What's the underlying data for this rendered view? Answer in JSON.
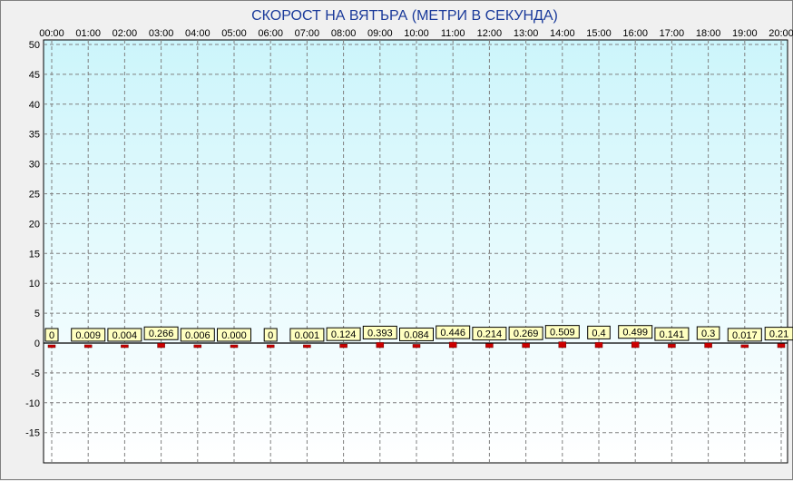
{
  "chart_data": {
    "type": "bar",
    "title": "СКОРОСТ НА ВЯТЪРА (МЕТРИ В СЕКУНДА)",
    "categories": [
      "00:00",
      "01:00",
      "02:00",
      "03:00",
      "04:00",
      "05:00",
      "06:00",
      "07:00",
      "08:00",
      "09:00",
      "10:00",
      "11:00",
      "12:00",
      "13:00",
      "14:00",
      "15:00",
      "16:00",
      "17:00",
      "18:00",
      "19:00",
      "20:00"
    ],
    "values": [
      0,
      0.009,
      0.004,
      0.266,
      0.006,
      0.0,
      0,
      0.001,
      0.124,
      0.393,
      0.084,
      0.446,
      0.214,
      0.269,
      0.509,
      0.4,
      0.499,
      0.141,
      0.3,
      0.017,
      0.21
    ],
    "labels": [
      "0",
      "0.009",
      "0.004",
      "0.266",
      "0.006",
      "0.000",
      "0",
      "0.001",
      "0.124",
      "0.393",
      "0.084",
      "0.446",
      "0.214",
      "0.269",
      "0.509",
      "0.4",
      "0.499",
      "0.141",
      "0.3",
      "0.017",
      "0.21"
    ],
    "xlabel": "",
    "ylabel": "",
    "ylim": [
      -20,
      50
    ],
    "yticks": [
      50,
      45,
      40,
      35,
      30,
      25,
      20,
      15,
      10,
      5,
      0,
      -5,
      -10,
      -15
    ],
    "xaxis_position": "top",
    "grid": true,
    "legend": "none",
    "colors": {
      "bar": "#cc0000",
      "label_bg": "#ffffc0",
      "plot_top": "#ccf5fb",
      "plot_bottom": "#ffffff",
      "title": "#1a3a9a",
      "grid": "#808080"
    }
  }
}
